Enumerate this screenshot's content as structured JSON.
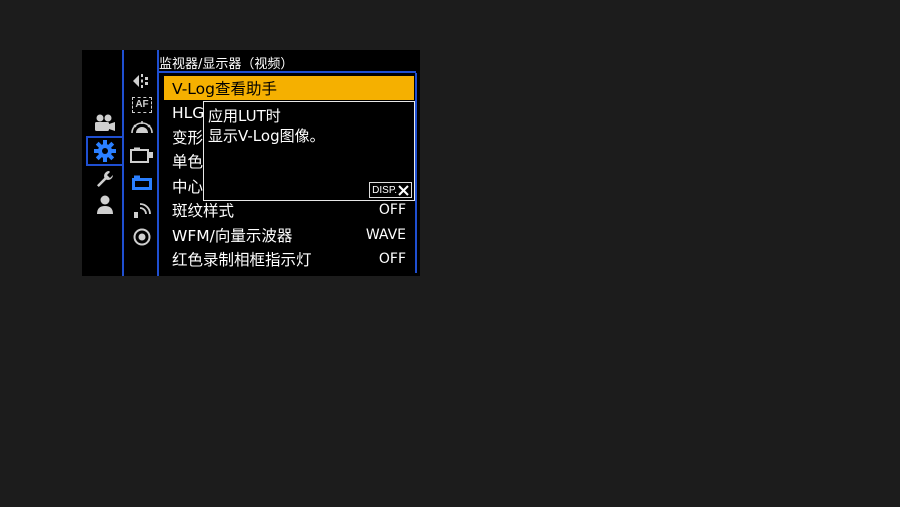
{
  "header": {
    "title": "监视器/显示器（视频）"
  },
  "main_tabs": [
    {
      "icon": "video-camera-icon"
    },
    {
      "icon": "gear-icon",
      "active": true
    },
    {
      "icon": "wrench-icon"
    },
    {
      "icon": "person-icon"
    }
  ],
  "sub_tabs": [
    {
      "icon": "focus-adjust-icon"
    },
    {
      "icon": "af-icon",
      "text": "AF"
    },
    {
      "icon": "exposure-meter-icon"
    },
    {
      "icon": "camera-outline-icon"
    },
    {
      "icon": "camera-filled-icon",
      "active": true
    },
    {
      "icon": "wireless-icon"
    },
    {
      "icon": "lens-icon"
    }
  ],
  "menu": {
    "items": [
      {
        "label": "V-Log查看助手",
        "value": "",
        "selected": true
      },
      {
        "label": "HLG",
        "value": ""
      },
      {
        "label": "变形",
        "value": ""
      },
      {
        "label": "单色",
        "value": ""
      },
      {
        "label": "中心",
        "value": ""
      },
      {
        "label": "斑纹样式",
        "value": "OFF"
      },
      {
        "label": "WFM/向量示波器",
        "value": "WAVE"
      },
      {
        "label": "红色录制相框指示灯",
        "value": "OFF"
      }
    ]
  },
  "popup": {
    "line1": "应用LUT时",
    "line2": "显示V-Log图像。",
    "disp_label": "DISP."
  },
  "colors": {
    "accent": "#f5b000",
    "divider": "#1f4fd1",
    "active_icon": "#2a7fff"
  }
}
